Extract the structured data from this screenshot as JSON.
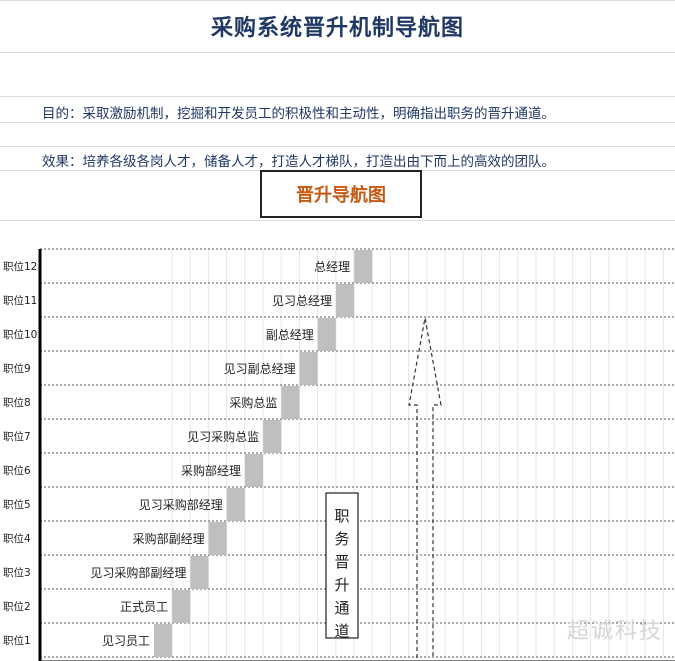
{
  "page": {
    "title": "采购系统晋升机制导航图",
    "purpose": "目的：采取激励机制，挖掘和开发员工的积极性和主动性，明确指出职务的晋升通道。",
    "effect": "效果：培养各级各岗人才，储备人才，打造人才梯队，打造出由下而上的高效的团队。",
    "nav_title": "晋升导航图",
    "watermark": "超诚科技"
  },
  "levels": [
    {
      "level": "职位1",
      "position": "见习员工"
    },
    {
      "level": "职位2",
      "position": "正式员工"
    },
    {
      "level": "职位3",
      "position": "见习采购部副经理"
    },
    {
      "level": "职位4",
      "position": "采购部副经理"
    },
    {
      "level": "职位5",
      "position": "见习采购部经理"
    },
    {
      "level": "职位6",
      "position": "采购部经理"
    },
    {
      "level": "职位7",
      "position": "见习采购总监"
    },
    {
      "level": "职位8",
      "position": "采购总监"
    },
    {
      "level": "职位9",
      "position": "见习副总经理"
    },
    {
      "level": "职位10",
      "position": "副总经理"
    },
    {
      "level": "职位11",
      "position": "见习总经理"
    },
    {
      "level": "职位12",
      "position": "总经理"
    }
  ],
  "channel_label": "职务晋升通道",
  "colors": {
    "title": "#1f3864",
    "nav_title": "#c55a11",
    "step_fill": "#bfbfbf"
  }
}
